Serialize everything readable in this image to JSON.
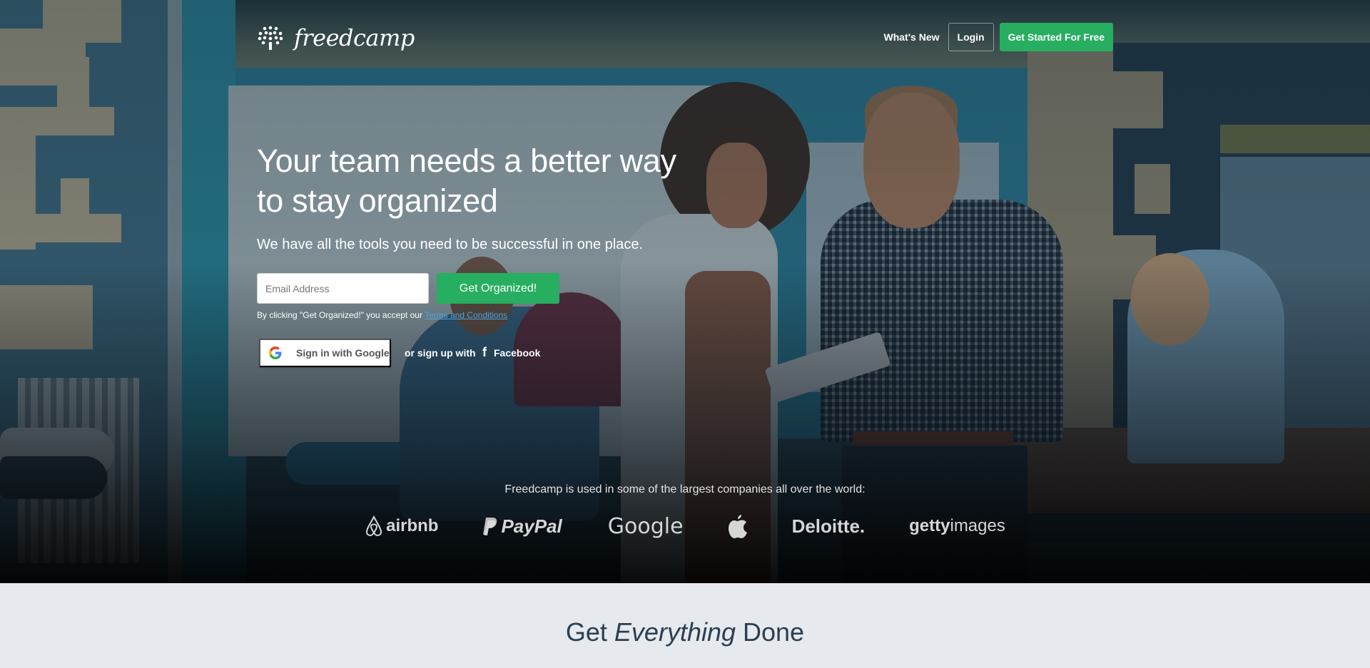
{
  "header": {
    "brand_name": "freedcamp",
    "logo_icon": "tree-people-icon",
    "nav": {
      "whats_new": "What's New",
      "login": "Login",
      "get_started": "Get Started For Free"
    }
  },
  "hero": {
    "headline_line1": "Your team needs a better way",
    "headline_line2": "to stay organized",
    "subheadline": "We have all the tools you need to be successful in one place.",
    "email_input": {
      "placeholder": "Email Address",
      "value": ""
    },
    "submit_label": "Get Organized!",
    "terms_prefix": "By clicking \"Get Organized!\" you accept our ",
    "terms_link": "Terms and Conditions",
    "google_button": "Sign in with Google",
    "or_text": "or sign up with",
    "facebook_label": "Facebook"
  },
  "companies": {
    "intro": "Freedcamp is used in some of the largest companies all over the world:",
    "logos": [
      {
        "name": "airbnb",
        "icon": "airbnb-icon"
      },
      {
        "name": "PayPal",
        "icon": "paypal-icon"
      },
      {
        "name": "Google"
      },
      {
        "name": "Apple",
        "icon": "apple-icon"
      },
      {
        "name": "Deloitte."
      },
      {
        "name_bold": "getty",
        "name_light": "images"
      }
    ]
  },
  "section": {
    "title_prefix": "Get ",
    "title_emphasis": "Everything",
    "title_suffix": " Done"
  },
  "colors": {
    "accent_green": "#27ae60",
    "link_blue": "#4aa3df",
    "section_bg": "#e6e9ee",
    "section_title": "#2c3e50"
  }
}
